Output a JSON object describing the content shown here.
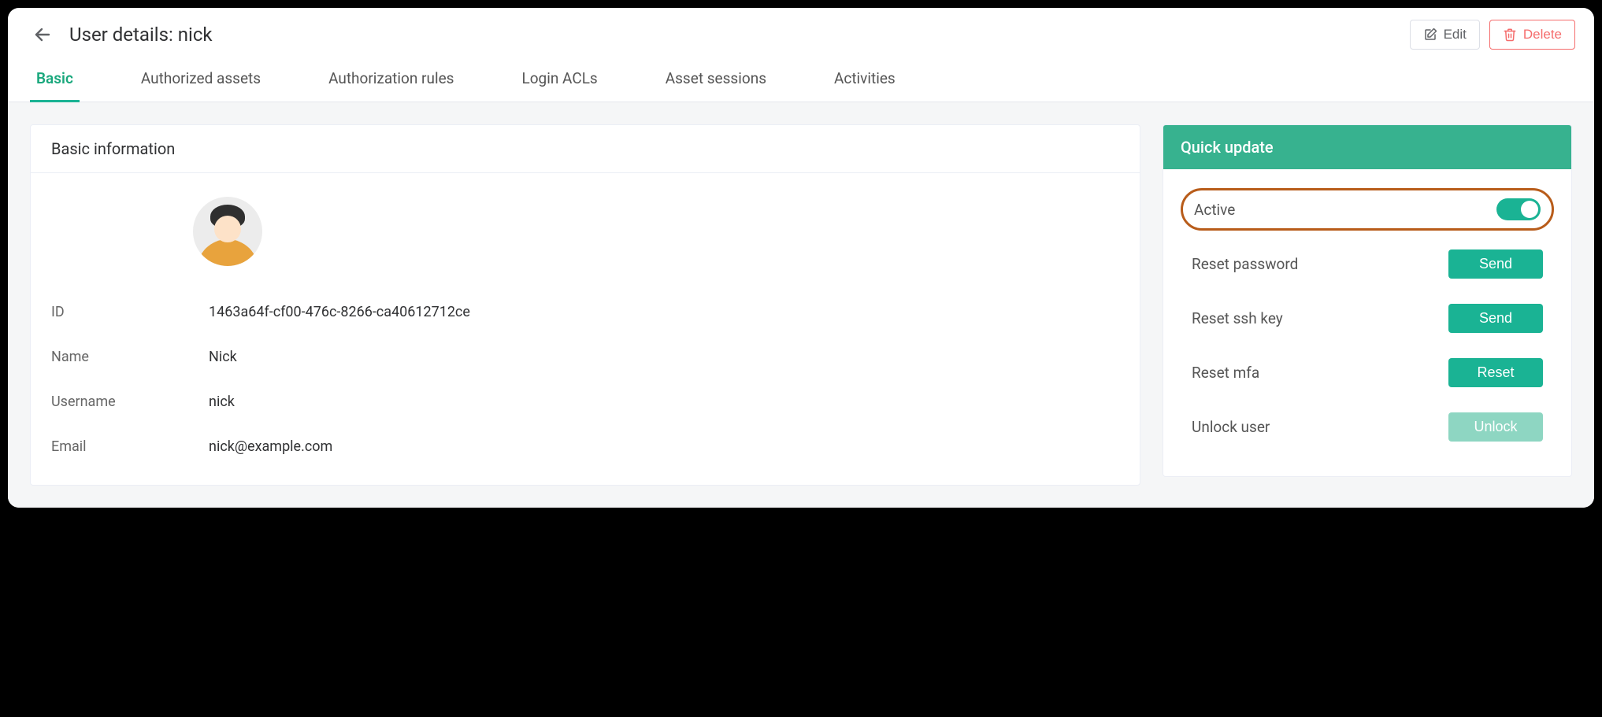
{
  "header": {
    "title": "User details: nick",
    "edit_label": "Edit",
    "delete_label": "Delete"
  },
  "tabs": {
    "basic": "Basic",
    "authorized_assets": "Authorized assets",
    "authorization_rules": "Authorization rules",
    "login_acls": "Login ACLs",
    "asset_sessions": "Asset sessions",
    "activities": "Activities"
  },
  "basic_card": {
    "title": "Basic information",
    "fields": {
      "id_label": "ID",
      "id_value": "1463a64f-cf00-476c-8266-ca40612712ce",
      "name_label": "Name",
      "name_value": "Nick",
      "username_label": "Username",
      "username_value": "nick",
      "email_label": "Email",
      "email_value": "nick@example.com"
    }
  },
  "quick_update": {
    "title": "Quick update",
    "active_label": "Active",
    "active_state": true,
    "reset_password_label": "Reset password",
    "reset_password_btn": "Send",
    "reset_ssh_label": "Reset ssh key",
    "reset_ssh_btn": "Send",
    "reset_mfa_label": "Reset mfa",
    "reset_mfa_btn": "Reset",
    "unlock_user_label": "Unlock user",
    "unlock_user_btn": "Unlock"
  },
  "colors": {
    "accent": "#1ab394",
    "danger": "#f56c6c",
    "highlight_border": "#b85c1a"
  }
}
